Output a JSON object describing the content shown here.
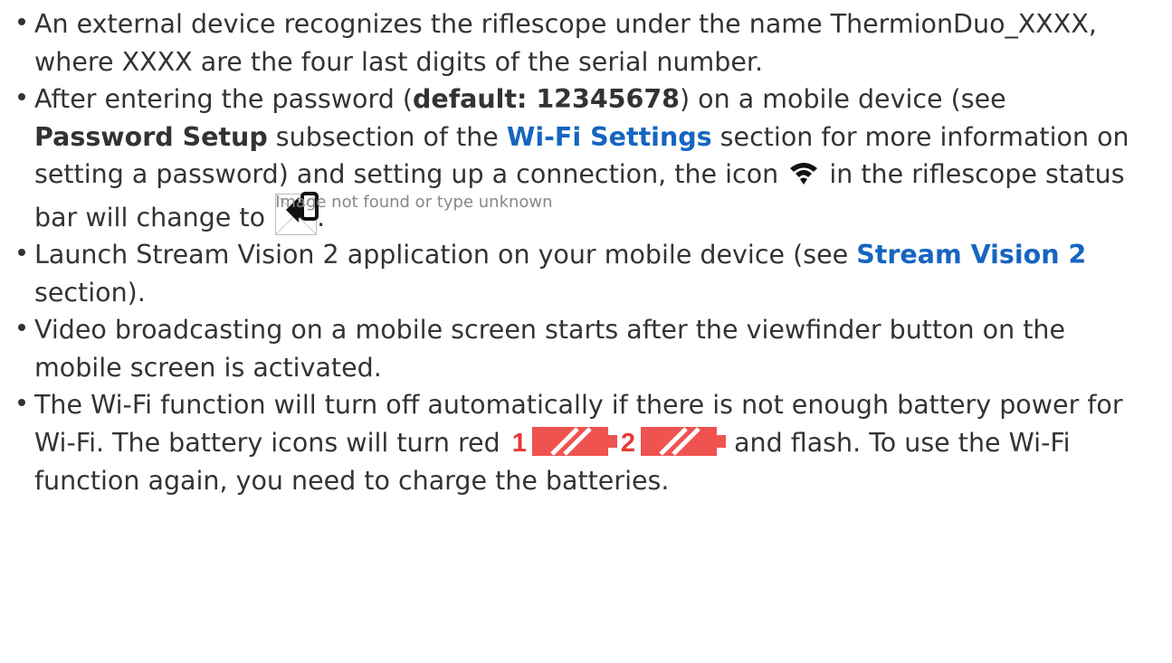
{
  "bullets": {
    "b1": {
      "text": "An external device recognizes the riflescope under the name ThermionDuo_XXXX, where XXXX are the four last digits of the serial number."
    },
    "b2": {
      "pre1": "After entering the password (",
      "bold_default": "default: 12345678",
      "pre2": ") on a mobile device (see ",
      "bold_password_setup": "Password Setup",
      "pre3": " subsection of the ",
      "link_wifi_settings": "Wi-Fi Settings",
      "pre4": " section for more information on setting a password) and setting up a connection, the icon ",
      "pre5": " in the riflescope status bar will change to ",
      "broken_image_alt": "Image not found or type unknown",
      "end": "."
    },
    "b3": {
      "pre1": "Launch Stream Vision 2 application on your mobile device (see ",
      "link_stream_vision": "Stream Vision 2",
      "end": " section)."
    },
    "b4": {
      "text": "Video broadcasting on a mobile screen starts after the viewfinder button on the mobile screen is activated."
    },
    "b5": {
      "pre1": "The Wi-Fi function will turn off automatically if there is not enough battery power for Wi-Fi. The battery icons will turn red ",
      "battery1_label": "1",
      "battery2_label": "2",
      "end": " and flash. To use the Wi-Fi function again, you need to charge the batteries."
    }
  },
  "icons": {
    "wifi": "wifi-icon",
    "wifi_phone": "wifi-phone-icon",
    "battery_empty": "battery-empty-icon",
    "broken_image": "broken-image-icon"
  },
  "colors": {
    "text": "#333333",
    "link": "#1565c0",
    "alert_red": "#e53935"
  }
}
